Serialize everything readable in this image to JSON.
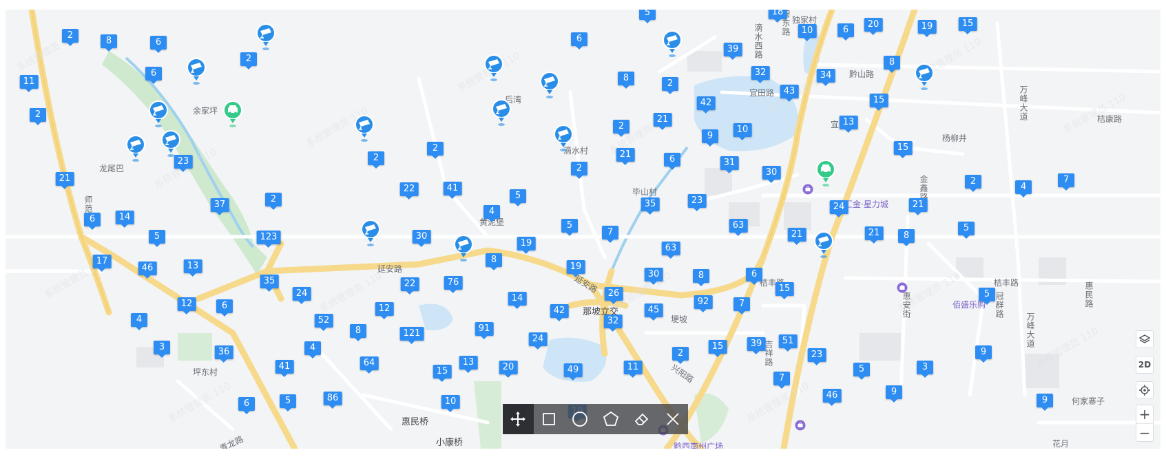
{
  "map": {
    "road_labels": [
      "师范街",
      "延安路",
      "延安路",
      "宜田路",
      "黔山路",
      "滴水西路",
      "碧东路",
      "万峰大道",
      "万峰大道",
      "桔丰路",
      "桔丰路",
      "桔康路",
      "金鑫路",
      "惠安街",
      "冠群路",
      "惠民路",
      "吉祥路",
      "兴阳路",
      "青龙路"
    ],
    "place_labels": [
      "余家坪",
      "龙尾巴",
      "后湾",
      "滴水村",
      "黄泥堡",
      "毕山村",
      "那坡立交",
      "埂坡",
      "坪东村",
      "惠民桥",
      "小康桥",
      "独家村",
      "宜田",
      "杨柳井",
      "何家寨子",
      "花月"
    ],
    "poi_labels": [
      "汇金·星力城",
      "佰盛乐购",
      "黔西南州广场"
    ],
    "watermark": "系统管理员 110 320114201810105752",
    "cluster_counts": [
      2,
      8,
      6,
      2,
      6,
      11,
      2,
      23,
      21,
      37,
      2,
      14,
      6,
      5,
      123,
      17,
      46,
      13,
      35,
      24,
      12,
      6,
      4,
      52,
      3,
      36,
      41,
      4,
      8,
      64,
      86,
      5,
      6,
      2,
      2,
      22,
      41,
      30,
      5,
      4,
      22,
      76,
      12,
      121,
      91,
      13,
      8,
      20,
      49,
      11,
      15,
      10,
      4,
      14,
      42,
      24,
      10,
      19,
      8,
      5,
      19,
      7,
      26,
      32,
      6,
      8,
      21,
      2,
      2,
      21,
      2,
      6,
      9,
      10,
      31,
      30,
      42,
      32,
      43,
      39,
      34,
      13,
      15,
      15,
      10,
      6,
      20,
      19,
      15,
      5,
      18,
      35,
      23,
      63,
      30,
      8,
      63,
      6,
      92,
      45,
      7,
      21,
      21,
      8,
      5,
      24,
      21,
      2,
      4,
      7,
      15,
      39,
      51,
      2,
      15,
      23,
      7,
      46,
      5,
      9,
      3,
      9,
      9,
      5
    ]
  },
  "toolbar": {
    "tools": [
      "move",
      "rectangle",
      "circle",
      "polygon",
      "eraser",
      "close"
    ]
  },
  "controls": {
    "mode_label": "2D",
    "zoom_in": "+",
    "zoom_out": "−"
  },
  "colors": {
    "marker": "#2e8df2",
    "camera_pin": "#2a8ee8",
    "parking_pin": "#35c98a",
    "poi": "#8a6bd6",
    "water": "#cde5f7",
    "park": "#cde9d0",
    "major_road": "#f6d98a"
  }
}
